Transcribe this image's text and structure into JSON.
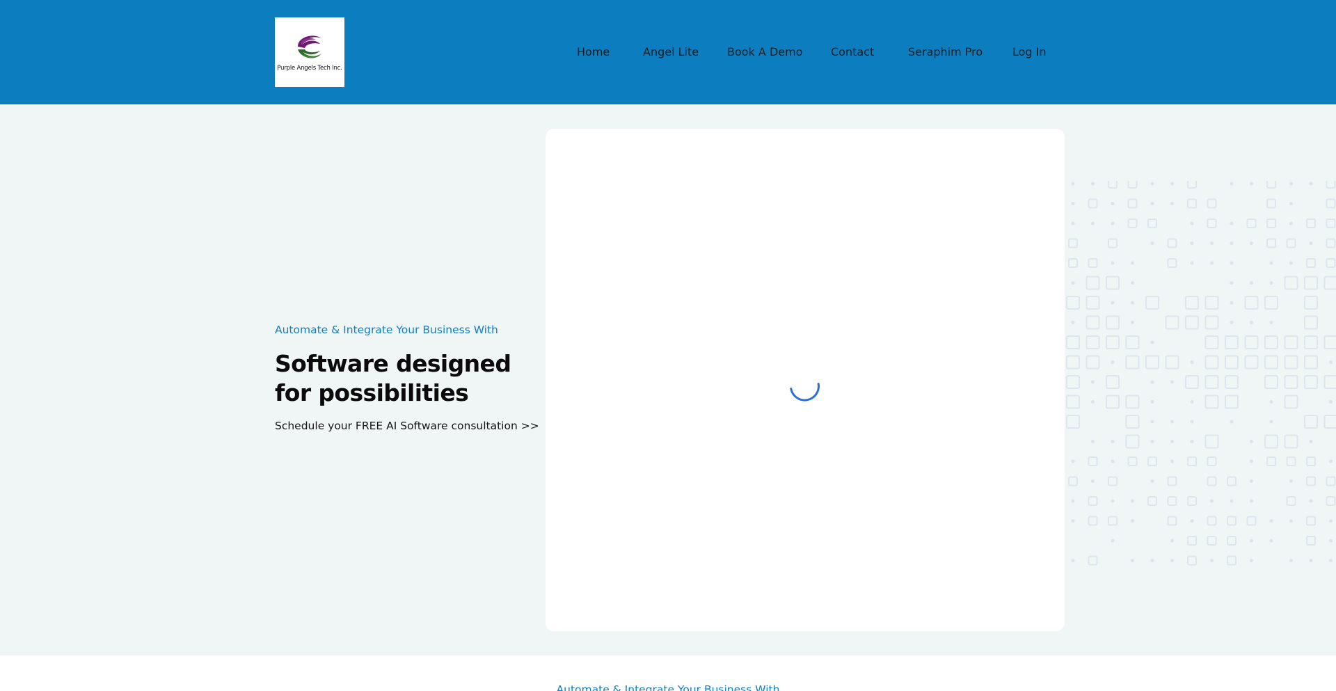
{
  "header": {
    "logo_text": "Purple Angels Tech Inc.",
    "nav": [
      "Home",
      "Angel Lite",
      "Book A Demo",
      "Contact",
      "Seraphim Pro",
      "Log In"
    ]
  },
  "hero": {
    "eyebrow": "Automate & Integrate Your Business With",
    "headline_line1": "Software designed",
    "headline_line2": "for possibilities",
    "cta": "Schedule your FREE AI Software consultation >>"
  },
  "lower": {
    "eyebrow": "Automate & Integrate Your Business With"
  },
  "colors": {
    "header_bg": "#0c7dbf",
    "accent": "#1281c1",
    "page_bg": "#f0f5f5",
    "spinner": "#2a6fd6",
    "logo_purple": "#6b1a6e",
    "logo_green": "#2e6b2a"
  }
}
